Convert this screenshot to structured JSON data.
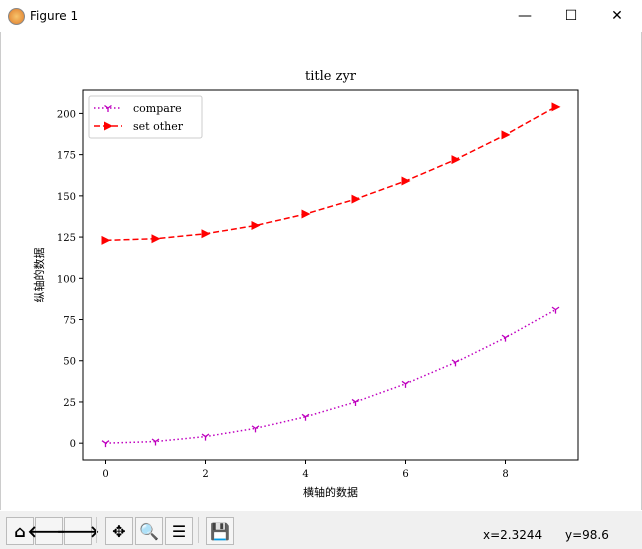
{
  "window": {
    "title": "Figure 1",
    "minimize": "—",
    "maximize": "☐",
    "close": "✕"
  },
  "toolbar": {
    "buttons": [
      {
        "name": "home-icon",
        "glyph": "⌂"
      },
      {
        "name": "back-arrow-icon",
        "glyph": "🡐"
      },
      {
        "name": "forward-arrow-icon",
        "glyph": "🡒"
      },
      {
        "name": "pan-icon",
        "glyph": "✥"
      },
      {
        "name": "zoom-icon",
        "glyph": "🔍"
      },
      {
        "name": "subplots-icon",
        "glyph": "☰"
      },
      {
        "name": "save-icon",
        "glyph": "💾"
      }
    ],
    "x_readout": "x=2.3244",
    "y_readout": "y=98.6"
  },
  "chart_data": {
    "type": "line",
    "title": "title zyr",
    "xlabel": "横轴的数据",
    "ylabel": "纵轴的数据",
    "x": [
      0,
      1,
      2,
      3,
      4,
      5,
      6,
      7,
      8,
      9
    ],
    "xlim": [
      -0.45,
      9.45
    ],
    "ylim": [
      -10.2,
      214.2
    ],
    "xticks": [
      0,
      2,
      4,
      6,
      8
    ],
    "yticks": [
      0,
      25,
      50,
      75,
      100,
      125,
      150,
      175,
      200
    ],
    "grid": false,
    "legend_position": "top-left",
    "series": [
      {
        "name": "compare",
        "values": [
          0,
          1,
          4,
          9,
          16,
          25,
          36,
          49,
          64,
          81
        ],
        "color": "#bf00bf",
        "linestyle": "dotted",
        "marker": "tri_down"
      },
      {
        "name": "set other",
        "values": [
          123,
          124,
          127,
          132,
          139,
          148,
          159,
          172,
          187,
          204
        ],
        "color": "#ff0000",
        "linestyle": "dashed",
        "marker": "triangle_right"
      }
    ]
  }
}
